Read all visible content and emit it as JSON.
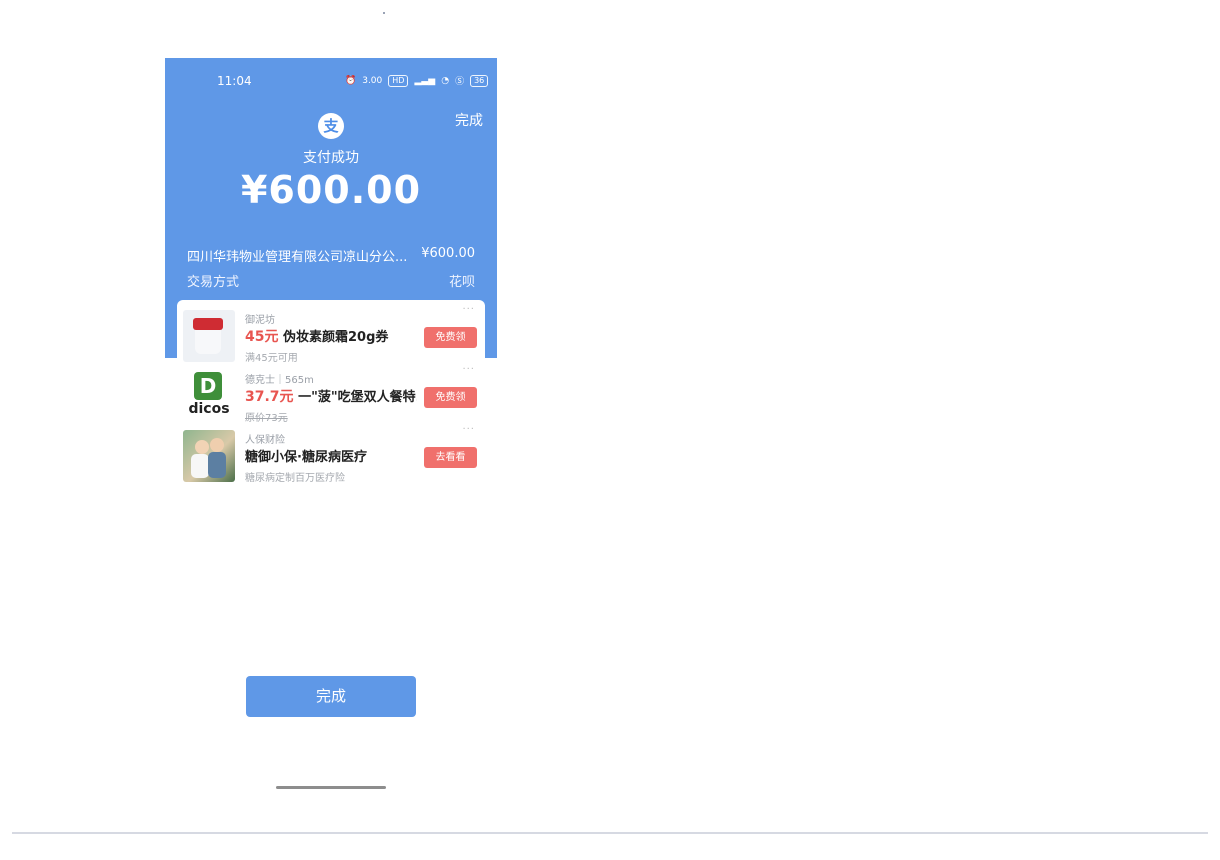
{
  "status_bar": {
    "time": "11:04",
    "icons": [
      "alarm-icon",
      "speed-indicator",
      "hd-badge",
      "signal-icon",
      "wifi-icon",
      "vpn-icon",
      "battery-icon"
    ],
    "speed": "3.00",
    "hd": "HD",
    "battery": "36"
  },
  "header": {
    "done_label": "完成"
  },
  "payment": {
    "logo_text": "支",
    "status": "支付成功",
    "amount": "¥600.00",
    "merchant": "四川华玮物业管理有限公司凉山分公...",
    "merchant_amount": "¥600.00",
    "method_label": "交易方式",
    "method_value": "花呗"
  },
  "ads": [
    {
      "brand": "御泥坊",
      "price": "45元",
      "title": "伪妆素颜霜20g券",
      "sub": "满45元可用",
      "button": "免费领",
      "more": "···",
      "icon": "cosmetic-jar-image"
    },
    {
      "brand": "德克士｜565m",
      "price": "37.7元",
      "title": "一\"菠\"吃堡双人餐特...",
      "sub": "原价73元",
      "button": "免费领",
      "more": "···",
      "icon": "dicos-logo",
      "logo_letter": "D",
      "logo_text": "dicos"
    },
    {
      "brand": "人保财险",
      "price": "",
      "title": "糖御小保·糖尿病医疗",
      "sub": "糖尿病定制百万医疗险",
      "button": "去看看",
      "more": "···",
      "icon": "elderly-couple-image"
    }
  ],
  "footer": {
    "done_label": "完成"
  },
  "colors": {
    "primary": "#5f98e7",
    "accent_red": "#e85550",
    "button_red": "#f0706c"
  }
}
